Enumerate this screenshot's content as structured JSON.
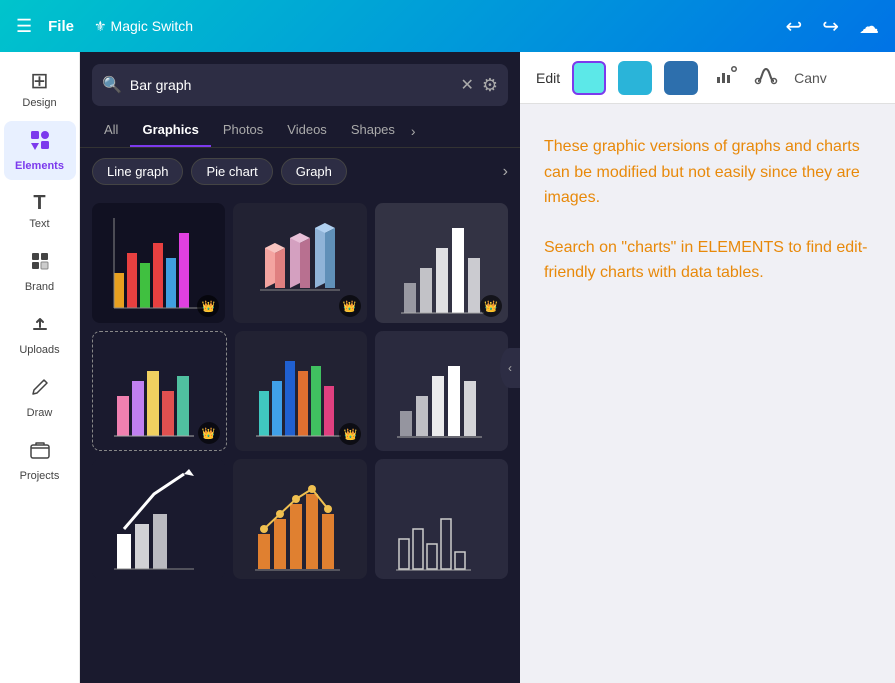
{
  "topbar": {
    "hamburger": "☰",
    "file_label": "File",
    "magic_label": "Magic Switch",
    "undo_label": "↩",
    "redo_label": "↪",
    "cloud_label": "☁",
    "canva_label": "Canv"
  },
  "sidebar": {
    "items": [
      {
        "id": "design",
        "label": "Design",
        "icon": "⊞"
      },
      {
        "id": "elements",
        "label": "Elements",
        "icon": "✦",
        "active": true
      },
      {
        "id": "text",
        "label": "Text",
        "icon": "T"
      },
      {
        "id": "brand",
        "label": "Brand",
        "icon": "🏷"
      },
      {
        "id": "uploads",
        "label": "Uploads",
        "icon": "⬆"
      },
      {
        "id": "draw",
        "label": "Draw",
        "icon": "✏"
      },
      {
        "id": "projects",
        "label": "Projects",
        "icon": "📁"
      }
    ]
  },
  "panel": {
    "search_placeholder": "Bar graph",
    "search_value": "Bar graph",
    "tabs": [
      {
        "id": "all",
        "label": "All"
      },
      {
        "id": "graphics",
        "label": "Graphics",
        "active": true
      },
      {
        "id": "photos",
        "label": "Photos"
      },
      {
        "id": "videos",
        "label": "Videos"
      },
      {
        "id": "shapes",
        "label": "Shapes"
      }
    ],
    "filters": [
      {
        "id": "line-graph",
        "label": "Line graph"
      },
      {
        "id": "pie-chart",
        "label": "Pie chart"
      },
      {
        "id": "graph",
        "label": "Graph"
      }
    ]
  },
  "content": {
    "edit_label": "Edit",
    "colors": [
      {
        "id": "cyan-light",
        "hex": "#5ce8e8"
      },
      {
        "id": "cyan-mid",
        "hex": "#2ab4d9"
      },
      {
        "id": "blue-dark",
        "hex": "#2d6fad"
      }
    ],
    "info_text_1": "These graphic versions of graphs and charts can be modified but not easily since they are images.",
    "info_text_2": "Search on \"charts\" in ELEMENTS to find edit-friendly charts with data tables."
  }
}
